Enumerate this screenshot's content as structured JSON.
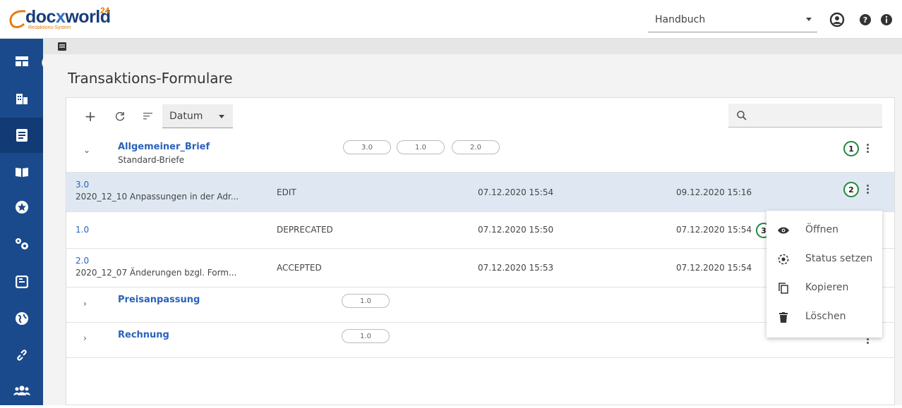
{
  "brand": {
    "name_a": "doc",
    "name_x": "x",
    "name_b": "world",
    "superscript": "24",
    "tagline": "Redaktions-System"
  },
  "topbar": {
    "selector_value": "Handbuch",
    "icons": [
      "user-circle-icon",
      "help-icon",
      "info-icon"
    ]
  },
  "sidebar": {
    "items": [
      "dashboard-icon",
      "buildings-icon",
      "forms-icon",
      "book-icon",
      "star-icon",
      "settings-icon",
      "document-icon",
      "globe-icon",
      "link-icon",
      "users-icon"
    ],
    "active_index": 2
  },
  "page": {
    "title": "Transaktions-Formulare"
  },
  "toolbar": {
    "add": "+",
    "sort_value": "Datum",
    "search_placeholder": ""
  },
  "groups": [
    {
      "name": "Allgemeiner_Brief",
      "subtitle": "Standard-Briefe",
      "versions": [
        "3.0",
        "1.0",
        "2.0"
      ],
      "expanded": true
    },
    {
      "name": "Preisanpassung",
      "subtitle": "",
      "versions": [
        "1.0"
      ],
      "expanded": false
    },
    {
      "name": "Rechnung",
      "subtitle": "",
      "versions": [
        "1.0"
      ],
      "expanded": false
    }
  ],
  "version_rows": [
    {
      "version": "3.0",
      "description": "2020_12_10 Anpassungen in der Adr...",
      "status": "EDIT",
      "created": "07.12.2020 15:54",
      "modified": "09.12.2020 15:16",
      "selected": true
    },
    {
      "version": "1.0",
      "description": "",
      "status": "DEPRECATED",
      "created": "07.12.2020 15:50",
      "modified": "07.12.2020 15:54",
      "selected": false
    },
    {
      "version": "2.0",
      "description": "2020_12_07 Änderungen bzgl. Form...",
      "status": "ACCEPTED",
      "created": "07.12.2020 15:53",
      "modified": "07.12.2020 15:54",
      "selected": false
    }
  ],
  "context_menu": {
    "items": [
      {
        "label": "Öffnen",
        "icon": "eye-icon"
      },
      {
        "label": "Status setzen",
        "icon": "status-circle-icon"
      },
      {
        "label": "Kopieren",
        "icon": "copy-icon"
      },
      {
        "label": "Löschen",
        "icon": "trash-icon"
      }
    ]
  },
  "annotations": [
    "1",
    "2",
    "3"
  ],
  "colors": {
    "sidebar": "#1a4a8c",
    "link": "#2a63b8",
    "badge": "#1f8a3a",
    "selected_row": "#dfe8f2"
  }
}
